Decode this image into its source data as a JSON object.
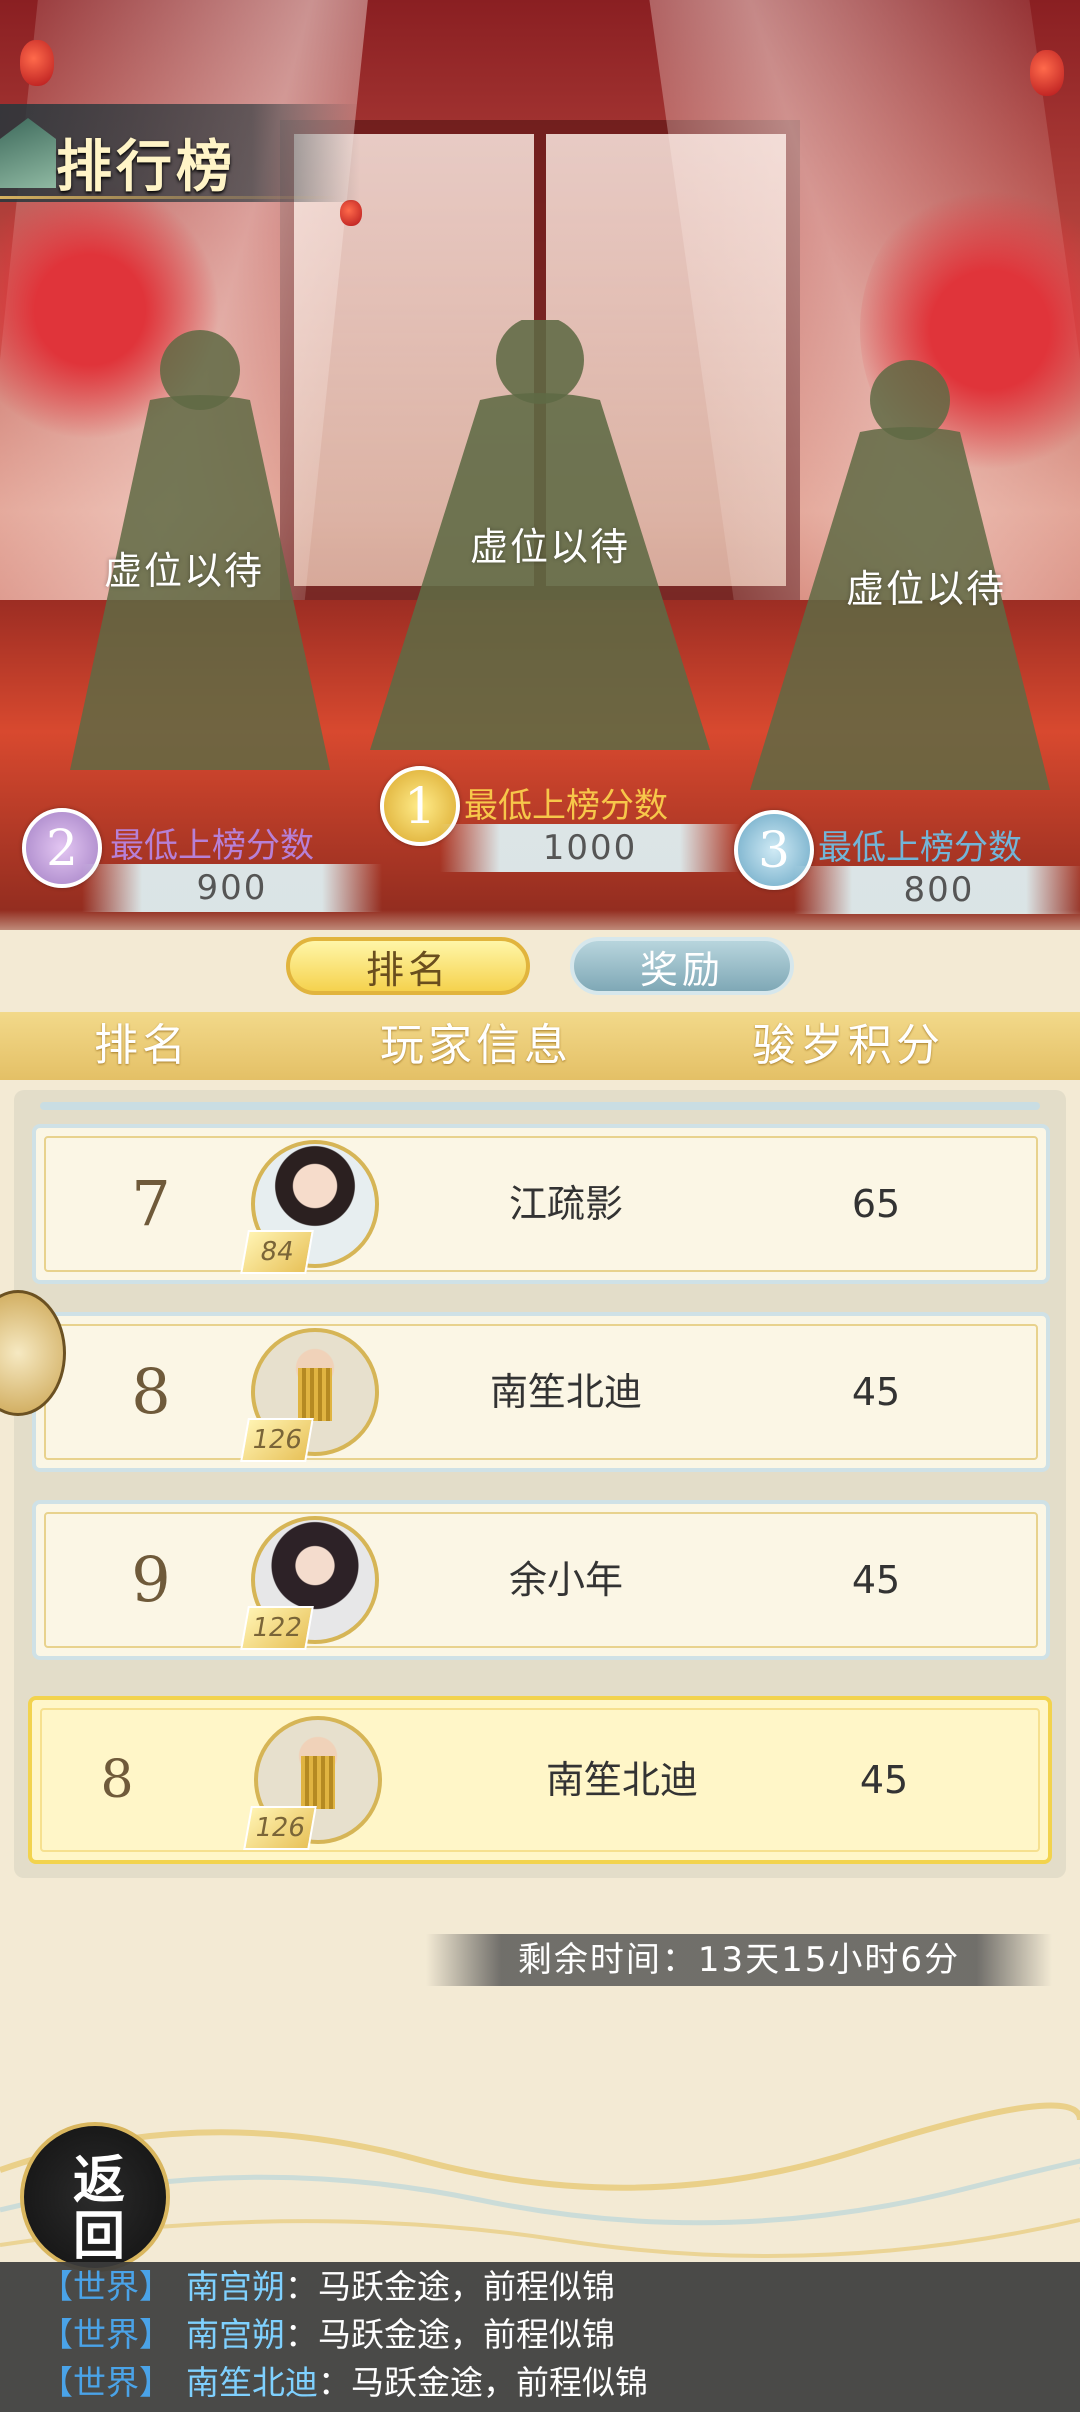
{
  "screen_title": "排行榜",
  "podium": {
    "first": {
      "rank": "1",
      "placeholder": "虚位以待",
      "label": "最低上榜分数",
      "score": "1000"
    },
    "second": {
      "rank": "2",
      "placeholder": "虚位以待",
      "label": "最低上榜分数",
      "score": "900"
    },
    "third": {
      "rank": "3",
      "placeholder": "虚位以待",
      "label": "最低上榜分数",
      "score": "800"
    }
  },
  "tabs": {
    "rank": "排名",
    "reward": "奖励"
  },
  "columns": {
    "rank": "排名",
    "player": "玩家信息",
    "score": "骏岁积分"
  },
  "rows": [
    {
      "rank": "7",
      "name": "江疏影",
      "level": "84",
      "score": "65"
    },
    {
      "rank": "8",
      "name": "南笙北迪",
      "level": "126",
      "score": "45"
    },
    {
      "rank": "9",
      "name": "余小年",
      "level": "122",
      "score": "45"
    }
  ],
  "self_row": {
    "rank": "8",
    "name": "南笙北迪",
    "level": "126",
    "score": "45"
  },
  "remaining_time": "剩余时间：13天15小时6分",
  "back": {
    "char1": "返",
    "char2": "回"
  },
  "chat": [
    {
      "channel": "【世界】",
      "sender": "南宫朔",
      "colon": "：",
      "message": "马跃金途，前程似锦"
    },
    {
      "channel": "【世界】",
      "sender": "南宫朔",
      "colon": "：",
      "message": "马跃金途，前程似锦"
    },
    {
      "channel": "【世界】",
      "sender": "南笙北迪",
      "colon": "：",
      "message": "马跃金途，前程似锦"
    }
  ],
  "colors": {
    "gold": "#f2d34e",
    "chat_channel": "#4aa3e8",
    "chat_sender": "#7fd1ff"
  }
}
